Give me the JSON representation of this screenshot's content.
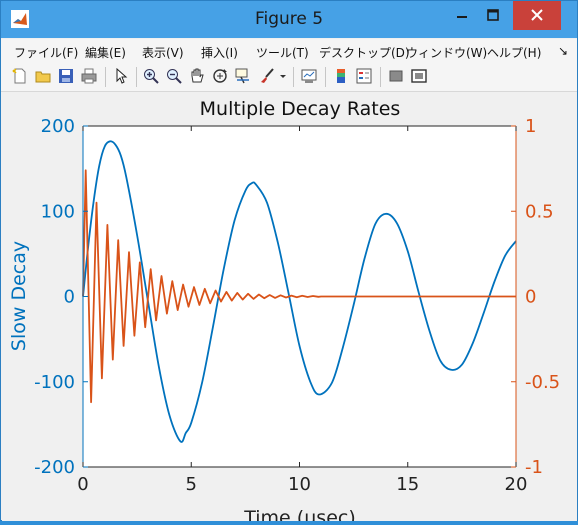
{
  "window": {
    "title": "Figure 5"
  },
  "menu": [
    "ファイル(F)",
    "編集(E)",
    "表示(V)",
    "挿入(I)",
    "ツール(T)",
    "デスクトップ(D)",
    "ウィンドウ(W)",
    "ヘルプ(H)"
  ],
  "menu_overflow": "↘",
  "toolbar": {
    "icons": [
      "new-figure-icon",
      "open-file-icon",
      "save-icon",
      "print-icon",
      "pointer-icon",
      "zoom-in-icon",
      "zoom-out-icon",
      "pan-icon",
      "rotate-3d-icon",
      "data-cursor-icon",
      "brush-icon",
      "brush-dropdown-icon",
      "link-plot-icon",
      "colorbar-icon",
      "legend-icon",
      "hide-plot-tools-icon",
      "show-plot-tools-icon"
    ]
  },
  "colors": {
    "left": "#0072bd",
    "right": "#d95319",
    "title_bar": "#46a1e6",
    "close_button": "#c9413a"
  },
  "chart_data": {
    "type": "line",
    "title": "Multiple Decay Rates",
    "xlabel": "Time (μsec)",
    "ylabel_left": "Slow Decay",
    "ylabel_right": "",
    "xlim": [
      0,
      20
    ],
    "ylim_left": [
      -200,
      200
    ],
    "ylim_right": [
      -1,
      1
    ],
    "xticks": [
      "0",
      "5",
      "10",
      "15",
      "20"
    ],
    "yticks_left": [
      "200",
      "100",
      "0",
      "-100",
      "-200"
    ],
    "yticks_right": [
      "1",
      "0.5",
      "0",
      "-0.5",
      "-1"
    ],
    "grid": false,
    "series": [
      {
        "axis": "left",
        "color": "#0072bd",
        "x": [
          0,
          0.25,
          0.5,
          0.75,
          1.0,
          1.25,
          1.5,
          1.75,
          2.0,
          2.5,
          3.0,
          3.5,
          4.0,
          4.5,
          4.75,
          5.0,
          5.5,
          6.0,
          6.5,
          7.0,
          7.5,
          7.8,
          8.0,
          8.5,
          9.0,
          9.5,
          10.0,
          10.5,
          10.9,
          11.5,
          12.0,
          12.5,
          13.0,
          13.5,
          14.0,
          14.5,
          15.0,
          15.5,
          16.0,
          16.5,
          17.0,
          17.5,
          18.0,
          18.5,
          19.0,
          19.5,
          20.0
        ],
        "values": [
          0,
          61,
          113,
          153,
          176,
          182,
          178,
          165,
          140,
          72,
          -5,
          -82,
          -140,
          -170,
          -160,
          -148,
          -101,
          -36,
          32,
          89,
          124,
          133,
          131,
          110,
          63,
          3,
          -58,
          -100,
          -115,
          -101,
          -60,
          -10,
          44,
          85,
          97,
          86,
          53,
          5,
          -40,
          -75,
          -86,
          -80,
          -55,
          -20,
          17,
          48,
          65
        ]
      },
      {
        "axis": "right",
        "color": "#d95319",
        "x": [
          0,
          0.125,
          0.375,
          0.625,
          0.875,
          1.125,
          1.375,
          1.625,
          1.875,
          2.125,
          2.375,
          2.625,
          2.875,
          3.125,
          3.375,
          3.625,
          3.875,
          4.125,
          4.375,
          4.625,
          4.875,
          5.125,
          5.375,
          5.625,
          5.875,
          6.125,
          6.375,
          6.625,
          6.875,
          7.125,
          7.375,
          7.625,
          7.875,
          8.125,
          8.375,
          8.625,
          8.875,
          9.125,
          9.375,
          9.625,
          9.875,
          10.125,
          10.375,
          10.625,
          10.875,
          11.0,
          11.5,
          20.0
        ],
        "values": [
          0,
          0.74,
          -0.62,
          0.55,
          -0.48,
          0.42,
          -0.37,
          0.33,
          -0.29,
          0.26,
          -0.23,
          0.2,
          -0.18,
          0.16,
          -0.14,
          0.12,
          -0.1,
          0.09,
          -0.08,
          0.07,
          -0.06,
          0.055,
          -0.05,
          0.045,
          -0.04,
          0.035,
          -0.03,
          0.027,
          -0.024,
          0.021,
          -0.018,
          0.016,
          -0.014,
          0.012,
          -0.01,
          0.009,
          -0.008,
          0.007,
          -0.006,
          0.005,
          -0.004,
          0.004,
          -0.003,
          0.003,
          -0.002,
          0.0,
          0.0,
          0.0
        ]
      }
    ]
  }
}
